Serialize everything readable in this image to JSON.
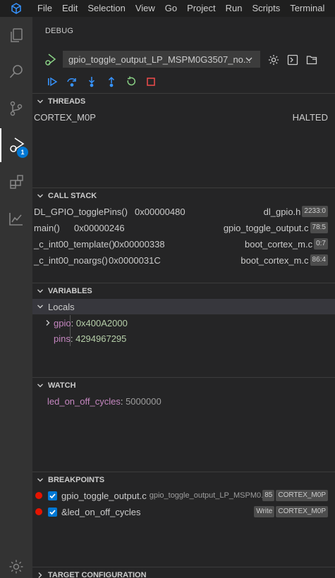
{
  "menu": [
    "File",
    "Edit",
    "Selection",
    "View",
    "Go",
    "Project",
    "Run",
    "Scripts",
    "Terminal"
  ],
  "activity": {
    "items": [
      "explorer-icon",
      "search-icon",
      "source-control-icon",
      "run-debug-icon",
      "extensions-icon",
      "graph-icon"
    ],
    "debug_badge": "1",
    "bottom": "settings-gear-icon"
  },
  "debug": {
    "title": "DEBUG",
    "config": "gpio_toggle_output_LP_MSPM0G3507_no..."
  },
  "threads": {
    "header": "THREADS",
    "items": [
      {
        "name": "CORTEX_M0P",
        "state": "HALTED"
      }
    ]
  },
  "call_stack": {
    "header": "CALL STACK",
    "frames": [
      {
        "func": "DL_GPIO_togglePins()",
        "addr": "0x00000480",
        "file": "dl_gpio.h",
        "pos": "2233:0"
      },
      {
        "func": "main()",
        "addr": "0x00000246",
        "file": "gpio_toggle_output.c",
        "pos": "78:5"
      },
      {
        "func": "_c_int00_template()",
        "addr": "0x00000338",
        "file": "boot_cortex_m.c",
        "pos": "0:7"
      },
      {
        "func": "_c_int00_noargs()",
        "addr": "0x0000031C",
        "file": "boot_cortex_m.c",
        "pos": "86:4"
      }
    ]
  },
  "variables": {
    "header": "VARIABLES",
    "scope": "Locals",
    "items": [
      {
        "name": "gpio",
        "value": "0x400A2000"
      },
      {
        "name": "pins",
        "value": "4294967295"
      }
    ]
  },
  "watch": {
    "header": "WATCH",
    "items": [
      {
        "name": "led_on_off_cycles",
        "value": "5000000"
      }
    ]
  },
  "breakpoints": {
    "header": "BREAKPOINTS",
    "items": [
      {
        "label": "gpio_toggle_output.c",
        "detail": "gpio_toggle_output_LP_MSPM0...",
        "tag1": "85",
        "tag2": "CORTEX_M0P"
      },
      {
        "label": "&led_on_off_cycles",
        "detail": "",
        "tag1": "Write",
        "tag2": "CORTEX_M0P"
      }
    ]
  },
  "target_config": {
    "header": "TARGET CONFIGURATION"
  }
}
